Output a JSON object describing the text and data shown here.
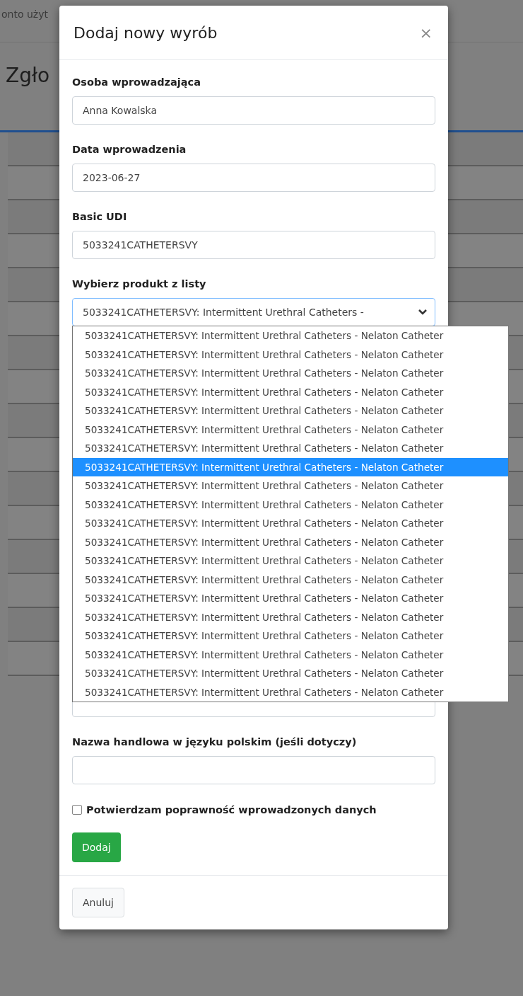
{
  "background": {
    "account_text": "onto użyt",
    "heading": "Zgło"
  },
  "modal": {
    "title": "Dodaj nowy wyrób",
    "close": "×",
    "fields": [
      {
        "kind": "input",
        "label": "Osoba wprowadzająca",
        "value": "Anna Kowalska"
      },
      {
        "kind": "input",
        "label": "Data wprowadzenia",
        "value": "2023-06-27"
      },
      {
        "kind": "input",
        "label": "Basic UDI",
        "value": "5033241CATHETERSVY"
      },
      {
        "kind": "select",
        "label": "Wybierz produkt z listy",
        "value": "5033241CATHETERSVY: Intermittent Urethral Catheters -",
        "expanded": true,
        "options": [
          {
            "text": "5033241CATHETERSVY: Intermittent Urethral Catheters - Nelaton Catheter",
            "selected": false
          },
          {
            "text": "5033241CATHETERSVY: Intermittent Urethral Catheters - Nelaton Catheter",
            "selected": false
          },
          {
            "text": "5033241CATHETERSVY: Intermittent Urethral Catheters - Nelaton Catheter",
            "selected": false
          },
          {
            "text": "5033241CATHETERSVY: Intermittent Urethral Catheters - Nelaton Catheter",
            "selected": false
          },
          {
            "text": "5033241CATHETERSVY: Intermittent Urethral Catheters - Nelaton Catheter",
            "selected": false
          },
          {
            "text": "5033241CATHETERSVY: Intermittent Urethral Catheters - Nelaton Catheter",
            "selected": false
          },
          {
            "text": "5033241CATHETERSVY: Intermittent Urethral Catheters - Nelaton Catheter",
            "selected": false
          },
          {
            "text": "5033241CATHETERSVY: Intermittent Urethral Catheters - Nelaton Catheter",
            "selected": true
          },
          {
            "text": "5033241CATHETERSVY: Intermittent Urethral Catheters - Nelaton Catheter",
            "selected": false
          },
          {
            "text": "5033241CATHETERSVY: Intermittent Urethral Catheters - Nelaton Catheter",
            "selected": false
          },
          {
            "text": "5033241CATHETERSVY: Intermittent Urethral Catheters - Nelaton Catheter",
            "selected": false
          },
          {
            "text": "5033241CATHETERSVY: Intermittent Urethral Catheters - Nelaton Catheter",
            "selected": false
          },
          {
            "text": "5033241CATHETERSVY: Intermittent Urethral Catheters - Nelaton Catheter",
            "selected": false
          },
          {
            "text": "5033241CATHETERSVY: Intermittent Urethral Catheters - Nelaton Catheter",
            "selected": false
          },
          {
            "text": "5033241CATHETERSVY: Intermittent Urethral Catheters - Nelaton Catheter",
            "selected": false
          },
          {
            "text": "5033241CATHETERSVY: Intermittent Urethral Catheters - Nelaton Catheter",
            "selected": false
          },
          {
            "text": "5033241CATHETERSVY: Intermittent Urethral Catheters - Nelaton Catheter",
            "selected": false
          },
          {
            "text": "5033241CATHETERSVY: Intermittent Urethral Catheters - Nelaton Catheter",
            "selected": false
          },
          {
            "text": "5033241CATHETERSVY: Intermittent Urethral Catheters - Nelaton Catheter",
            "selected": false
          },
          {
            "text": "5033241CATHETERSVY: Intermittent Urethral Catheters - Nelaton Catheter",
            "selected": false
          }
        ]
      },
      {
        "kind": "input"
      },
      {
        "kind": "input",
        "label": "Nazwa handlowa w języku polskim (jeśli dotyczy)"
      }
    ],
    "confirm": {
      "label": "Potwierdzam poprawność wprowadzonych danych",
      "checked": false
    },
    "submit": "Dodaj",
    "cancel": "Anuluj"
  }
}
